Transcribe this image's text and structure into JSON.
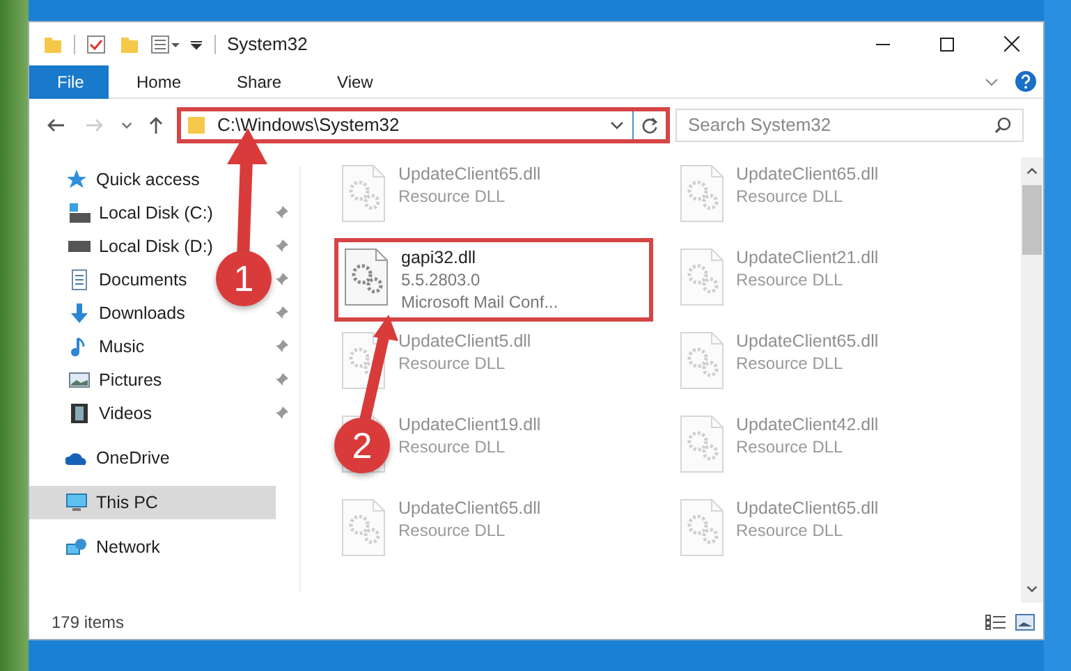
{
  "window": {
    "title": "System32"
  },
  "ribbon_tabs": [
    {
      "label": "File",
      "selected": true
    },
    {
      "label": "Home",
      "selected": false
    },
    {
      "label": "Share",
      "selected": false
    },
    {
      "label": "View",
      "selected": false
    }
  ],
  "address_bar": {
    "path": "C:\\Windows\\System32",
    "highlighted": true
  },
  "search": {
    "placeholder": "Search System32"
  },
  "sidebar": {
    "items": [
      {
        "label": "Quick access",
        "kind": "quick",
        "pinned": false,
        "selected": false,
        "children": [
          {
            "label": "Local Disk (C:)",
            "kind": "drive-c",
            "pinned": true,
            "selected": false
          },
          {
            "label": "Local Disk (D:)",
            "kind": "drive",
            "pinned": true,
            "selected": false
          },
          {
            "label": "Documents",
            "kind": "documents",
            "pinned": true,
            "selected": false
          },
          {
            "label": "Downloads",
            "kind": "downloads",
            "pinned": true,
            "selected": false
          },
          {
            "label": "Music",
            "kind": "music",
            "pinned": true,
            "selected": false
          },
          {
            "label": "Pictures",
            "kind": "pictures",
            "pinned": true,
            "selected": false
          },
          {
            "label": "Videos",
            "kind": "videos",
            "pinned": true,
            "selected": false
          }
        ]
      },
      {
        "label": "OneDrive",
        "kind": "cloud",
        "pinned": false,
        "selected": false
      },
      {
        "label": "This PC",
        "kind": "pc",
        "pinned": false,
        "selected": true
      },
      {
        "label": "Network",
        "kind": "network",
        "pinned": false,
        "selected": false
      }
    ]
  },
  "files": [
    {
      "name": "UpdateClient65.dll",
      "lines": [
        "Resource DLL"
      ],
      "faded": true,
      "highlighted": false
    },
    {
      "name": "UpdateClient65.dll",
      "lines": [
        "Resource DLL"
      ],
      "faded": true,
      "highlighted": false
    },
    {
      "name": "gapi32.dll",
      "lines": [
        "5.5.2803.0",
        "Microsoft Mail Conf..."
      ],
      "faded": false,
      "highlighted": true
    },
    {
      "name": "UpdateClient21.dll",
      "lines": [
        "Resource DLL"
      ],
      "faded": true,
      "highlighted": false
    },
    {
      "name": "UpdateClient5.dll",
      "lines": [
        "Resource DLL"
      ],
      "faded": true,
      "highlighted": false
    },
    {
      "name": "UpdateClient65.dll",
      "lines": [
        "Resource DLL"
      ],
      "faded": true,
      "highlighted": false
    },
    {
      "name": "UpdateClient19.dll",
      "lines": [
        "Resource DLL"
      ],
      "faded": true,
      "highlighted": false
    },
    {
      "name": "UpdateClient42.dll",
      "lines": [
        "Resource DLL"
      ],
      "faded": true,
      "highlighted": false
    },
    {
      "name": "UpdateClient65.dll",
      "lines": [
        "Resource DLL"
      ],
      "faded": true,
      "highlighted": false
    },
    {
      "name": "UpdateClient65.dll",
      "lines": [
        "Resource DLL"
      ],
      "faded": true,
      "highlighted": false
    }
  ],
  "status_bar": {
    "count": "179 items"
  },
  "annotations": [
    {
      "number": "1"
    },
    {
      "number": "2"
    }
  ]
}
